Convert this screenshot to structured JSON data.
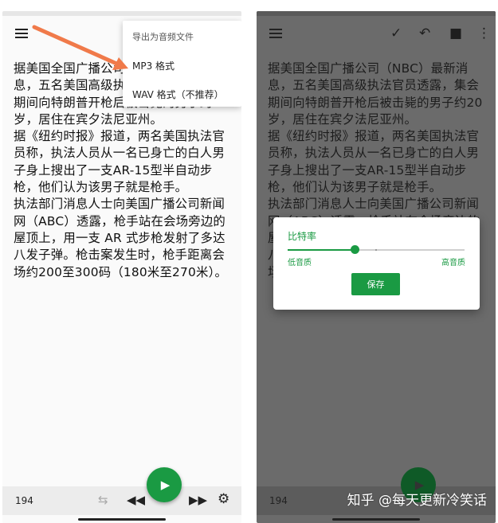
{
  "text_paragraphs": [
    "据美国全国广播公司（NBC）最新消息，五名美国高级执法官员透露，集会期间向特朗普开枪后被击毙的男子约20岁，居住在宾夕法尼亚州。",
    "据《纽约时报》报道，两名美国执法官员称，执法人员从一名已身亡的白人男子身上搜出了一支AR-15型半自动步枪，他们认为该男子就是枪手。",
    "执法部门消息人士向美国广播公司新闻网（ABC）透露，枪手站在会场旁边的屋顶上，用一支 AR 式步枪发射了多达八发子弹。枪击案发生时，枪手距离会场约200至300码（180米至270米）。"
  ],
  "left": {
    "dropdown": {
      "title": "导出为音频文件",
      "items": [
        "MP3 格式",
        "WAV 格式（不推荐）"
      ]
    },
    "counter": "194"
  },
  "right": {
    "counter": "194",
    "dialog": {
      "title": "比特率",
      "low_label": "低音质",
      "high_label": "高音质",
      "slider_value": 0.38,
      "save_label": "保存"
    }
  },
  "watermark": "知乎 @每天更新冷笑话",
  "colors": {
    "accent": "#1a9a43",
    "overlay": "#6b6b6b"
  },
  "icons": {
    "menu": "hamburger-icon",
    "check": "check-icon",
    "undo": "undo-icon",
    "delete": "trash-icon",
    "more": "more-vert-icon",
    "repeat": "repeat-icon",
    "rewind": "rewind-icon",
    "forward": "fast-forward-icon",
    "settings": "gear-icon",
    "play": "play-icon"
  }
}
